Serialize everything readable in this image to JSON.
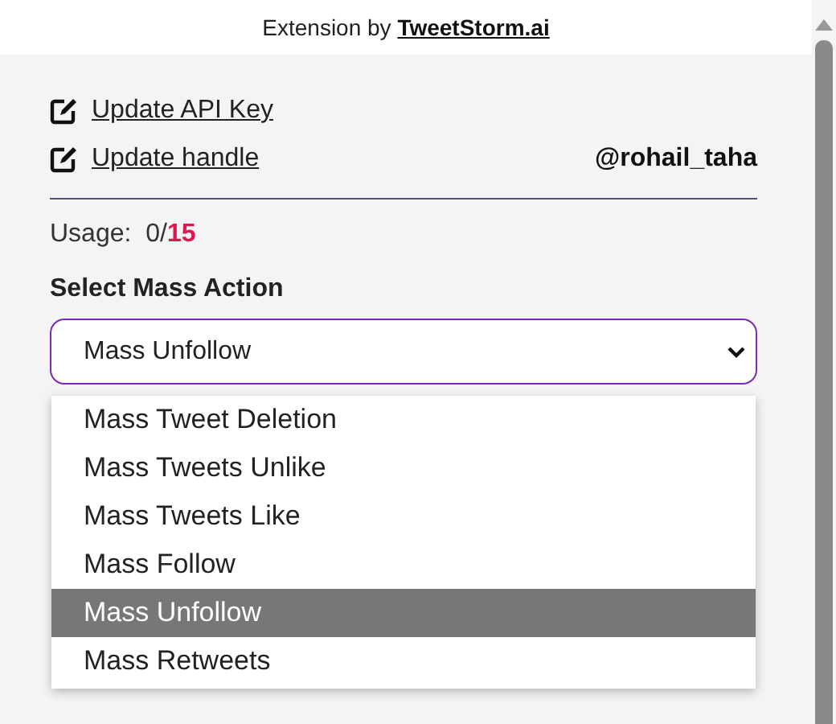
{
  "header": {
    "prefix": "Extension by",
    "link": "TweetStorm.ai"
  },
  "links": [
    {
      "label": "Update API Key"
    },
    {
      "label": "Update handle"
    }
  ],
  "handle": "@rohail_taha",
  "usage": "Usage:  0/**15**",
  "select": {
    "label": "Select Mass Action",
    "value": "Mass Unfollow",
    "expanded": true,
    "options": [
      {
        "label": "Mass Tweet Deletion",
        "selected": false
      },
      {
        "label": "Mass Tweets Unlike",
        "selected": false
      },
      {
        "label": "Mass Tweets Like",
        "selected": false
      },
      {
        "label": "Mass Follow",
        "selected": false
      },
      {
        "label": "Mass Unfollow",
        "selected": true
      },
      {
        "label": "Mass Retweets",
        "selected": false
      }
    ]
  }
}
